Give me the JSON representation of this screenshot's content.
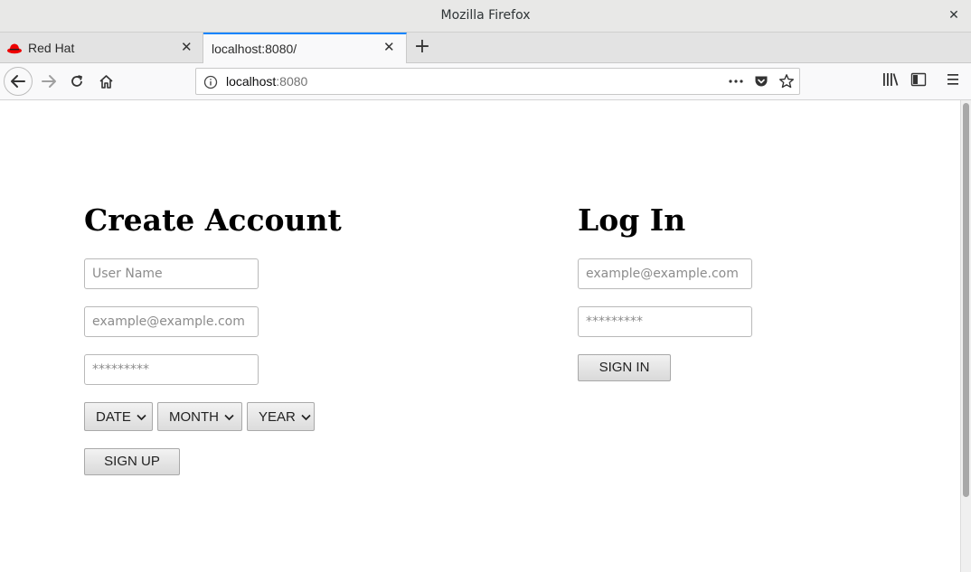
{
  "window": {
    "title": "Mozilla Firefox",
    "close_glyph": "✕"
  },
  "tabs": [
    {
      "label": "Red Hat",
      "icon": "redhat-icon",
      "close_glyph": "✕"
    },
    {
      "label": "localhost:8080/",
      "close_glyph": "✕"
    }
  ],
  "new_tab_glyph": "+",
  "urlbar": {
    "host": "localhost",
    "port": ":8080"
  },
  "create_account": {
    "heading": "Create Account",
    "username_placeholder": "User Name",
    "email_placeholder": "example@example.com",
    "password_placeholder": "*********",
    "date_label": "DATE",
    "month_label": "MONTH",
    "year_label": "YEAR",
    "signup_label": "SIGN UP"
  },
  "login": {
    "heading": "Log In",
    "email_placeholder": "example@example.com",
    "password_placeholder": "*********",
    "signin_label": "SIGN IN"
  },
  "colors": {
    "accent_tab": "#0a84ff",
    "redhat": "#e00"
  }
}
